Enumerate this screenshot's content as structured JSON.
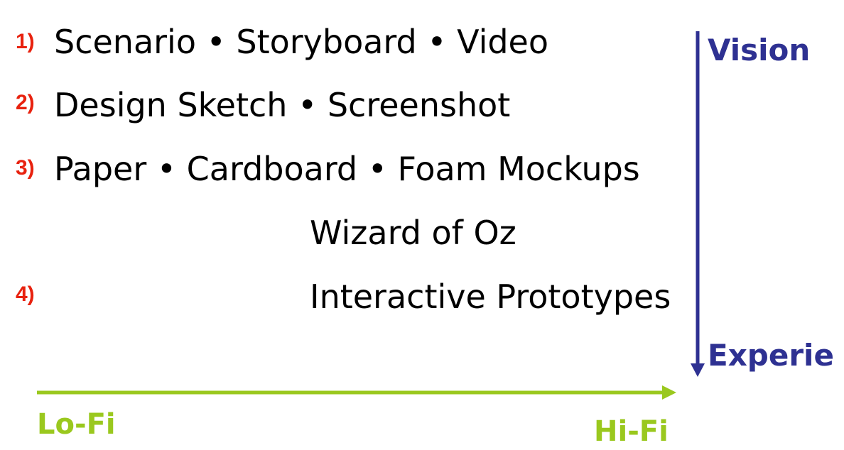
{
  "items": [
    {
      "number": "1)",
      "parts": [
        "Scenario",
        "Storyboard",
        "Video"
      ]
    },
    {
      "number": "2)",
      "parts": [
        "Design Sketch",
        "Screenshot"
      ]
    },
    {
      "number": "3)",
      "parts": [
        "Paper",
        "Cardboard",
        "Foam Mockups"
      ]
    },
    {
      "text": "Wizard of Oz"
    },
    {
      "number": "4)",
      "text": "Interactive Prototypes"
    }
  ],
  "separator": "•",
  "vertical_axis": {
    "top_label": "Vision",
    "bottom_label": "Experie",
    "color": "#2e3192"
  },
  "horizontal_axis": {
    "left_label": "Lo-Fi",
    "right_label": "Hi-Fi",
    "color": "#9ac81e"
  },
  "number_color": "#e8220f",
  "icons": [
    "arrow-down",
    "arrow-right"
  ]
}
